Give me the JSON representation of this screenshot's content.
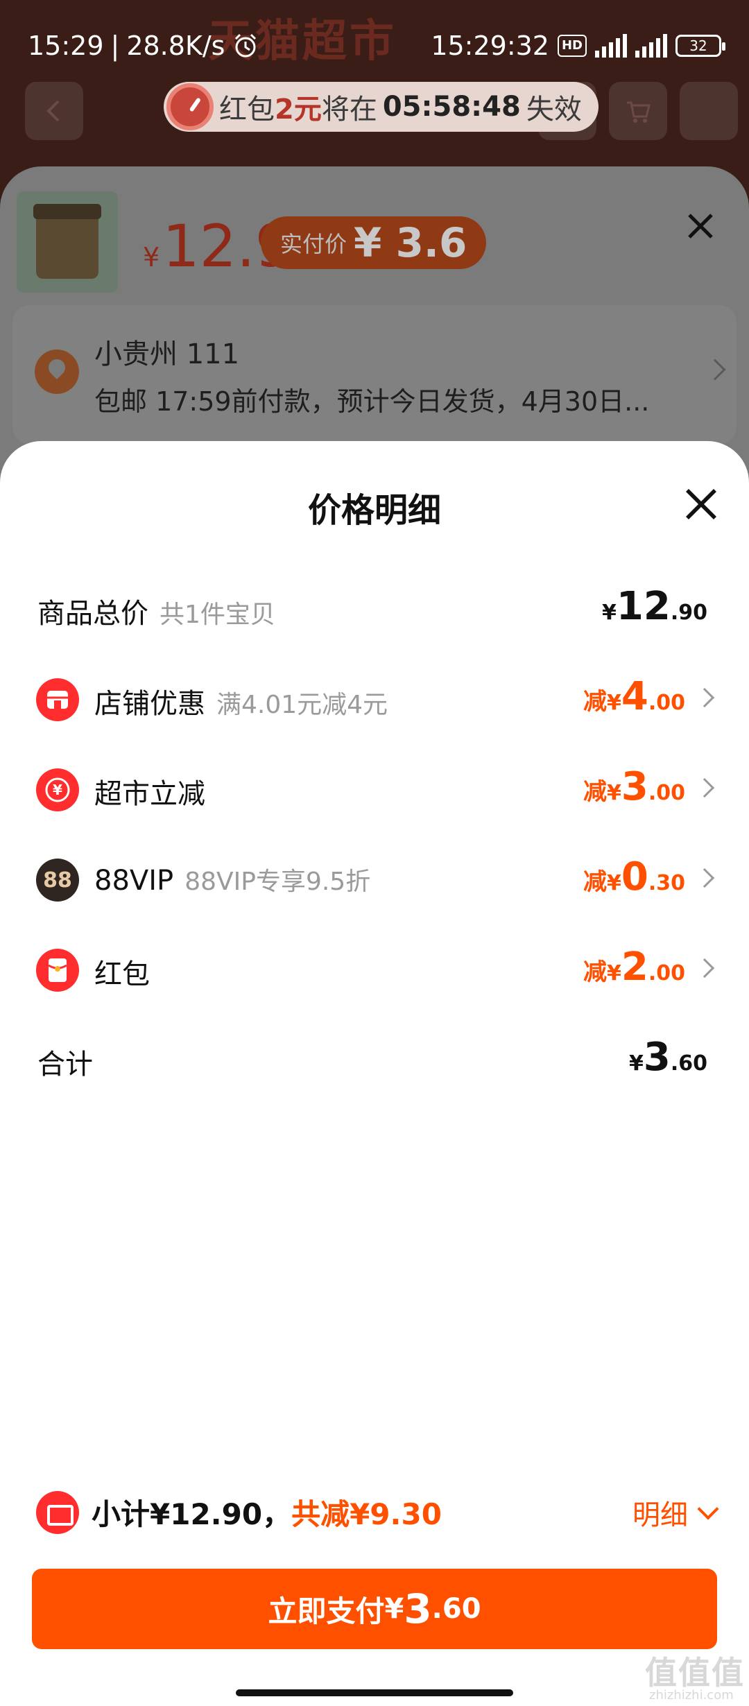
{
  "status_bar": {
    "time": "15:29",
    "net_speed": "28.8K/s",
    "clock_time": "15:29:32",
    "hd_label": "HD",
    "battery": "32"
  },
  "background": {
    "banner_text": "天猫超市",
    "redpack_prefix": "红包",
    "redpack_amount": "2元",
    "redpack_mid": "将在",
    "countdown": "05:58:48",
    "redpack_suffix": "失效"
  },
  "product": {
    "currency": "¥",
    "price": "12.9",
    "pay_label": "实付价",
    "pay_value": "¥ 3.6"
  },
  "address": {
    "name": "小贵州 111",
    "detail": "包邮 17:59前付款，预计今日发货，4月30日..."
  },
  "price_detail": {
    "title": "价格明细",
    "rows": [
      {
        "label": "商品总价",
        "sub": "共1件宝贝",
        "prefix": "",
        "currency": "¥",
        "int": "12",
        "dec": ".90"
      },
      {
        "label": "店铺优惠",
        "sub": "满4.01元减4元",
        "prefix": "减",
        "currency": "¥",
        "int": "4",
        "dec": ".00",
        "icon": "store-icon"
      },
      {
        "label": "超市立减",
        "sub": "",
        "prefix": "减",
        "currency": "¥",
        "int": "3",
        "dec": ".00",
        "icon": "yuan-refund-icon"
      },
      {
        "label": "88VIP",
        "sub": "88VIP专享9.5折",
        "prefix": "减",
        "currency": "¥",
        "int": "0",
        "dec": ".30",
        "icon": "vip-88-icon"
      },
      {
        "label": "红包",
        "sub": "",
        "prefix": "减",
        "currency": "¥",
        "int": "2",
        "dec": ".00",
        "icon": "red-envelope-icon"
      },
      {
        "label": "合计",
        "sub": "",
        "prefix": "",
        "currency": "¥",
        "int": "3",
        "dec": ".60"
      }
    ],
    "icon_text_88": "88",
    "icon_text_yuan": "¥"
  },
  "footer": {
    "subtotal_label": "小计¥12.90，",
    "discount_label": "共减¥9.30",
    "detail_toggle": "明细",
    "pay_button_label": "立即支付",
    "pay_currency": "¥",
    "pay_int": "3",
    "pay_dec": ".60"
  },
  "colors": {
    "accent": "#ff5000",
    "icon_red": "#ff2d2d"
  }
}
